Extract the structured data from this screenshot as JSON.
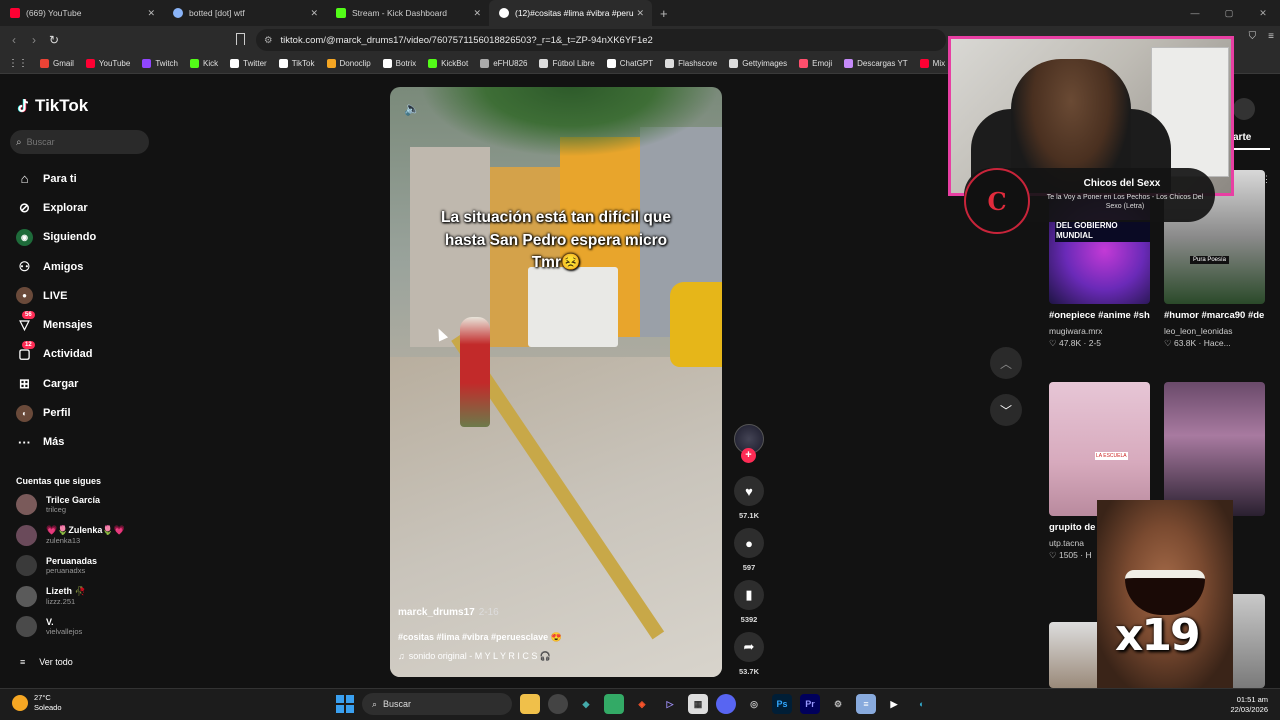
{
  "browser": {
    "tabs": [
      {
        "label": "(669) YouTube",
        "color": "#ff0033"
      },
      {
        "label": "botted [dot] wtf",
        "color": "#8ab4f8"
      },
      {
        "label": "Stream - Kick Dashboard",
        "color": "#53fc18"
      },
      {
        "label": "(12)#cositas #lima #vibra #peru",
        "color": "#ffffff"
      }
    ],
    "url": "tiktok.com/@marck_drums17/video/7607571156018826503?_r=1&_t=ZP-94nXK6YF1e2",
    "bookmarks": [
      {
        "label": "Gmail",
        "color": "#ea4335"
      },
      {
        "label": "YouTube",
        "color": "#ff0033"
      },
      {
        "label": "Twitch",
        "color": "#9146ff"
      },
      {
        "label": "Kick",
        "color": "#53fc18"
      },
      {
        "label": "Twitter",
        "color": "#ffffff"
      },
      {
        "label": "TikTok",
        "color": "#ffffff"
      },
      {
        "label": "Donoclip",
        "color": "#f5a623"
      },
      {
        "label": "Botrix",
        "color": "#ffffff"
      },
      {
        "label": "KickBot",
        "color": "#53fc18"
      },
      {
        "label": "eFHU826",
        "color": "#aaaaaa"
      },
      {
        "label": "Fútbol Libre",
        "color": "#dddddd"
      },
      {
        "label": "ChatGPT",
        "color": "#ffffff"
      },
      {
        "label": "Flashscore",
        "color": "#dddddd"
      },
      {
        "label": "Gettyimages",
        "color": "#dddddd"
      },
      {
        "label": "Emoji",
        "color": "#ff4f6d"
      },
      {
        "label": "Descargas YT",
        "color": "#c58af9"
      },
      {
        "label": "Mix N",
        "color": "#ff0033"
      }
    ]
  },
  "tiktok": {
    "logo": "TikTok",
    "search_placeholder": "Buscar",
    "menu": [
      {
        "label": "Para ti",
        "icon": "home-icon",
        "glyph": "⌂"
      },
      {
        "label": "Explorar",
        "icon": "compass-icon",
        "glyph": "⊘"
      },
      {
        "label": "Siguiendo",
        "icon": "following-icon",
        "glyph": "◉"
      },
      {
        "label": "Amigos",
        "icon": "friends-icon",
        "glyph": "⚇"
      },
      {
        "label": "LIVE",
        "icon": "live-icon",
        "glyph": "●"
      },
      {
        "label": "Mensajes",
        "icon": "messages-icon",
        "glyph": "▽",
        "badge": "56"
      },
      {
        "label": "Actividad",
        "icon": "activity-icon",
        "glyph": "▢",
        "badge": "12"
      },
      {
        "label": "Cargar",
        "icon": "upload-icon",
        "glyph": "⊞"
      },
      {
        "label": "Perfil",
        "icon": "profile-icon",
        "glyph": "◐"
      },
      {
        "label": "Más",
        "icon": "more-icon",
        "glyph": "···"
      }
    ],
    "following_header": "Cuentas que sigues",
    "following": [
      {
        "name": "Trilce García",
        "handle": "trilceg"
      },
      {
        "name": "💗🌷Zulenka🌷💗",
        "handle": "zulenka13"
      },
      {
        "name": "Peruanadas",
        "handle": "peruanadxs"
      },
      {
        "name": "Lizeth 🥀",
        "handle": "lizzz.251"
      },
      {
        "name": "V.",
        "handle": "vielvallejos"
      }
    ],
    "see_all": "Ver todo",
    "video": {
      "caption": "La situación está tan difícil que hasta San Pedro espera micro Tmr😣",
      "author": "marck_drums17",
      "date": "2-16",
      "description": "#cositas #lima #vibra #peruesclave 😍",
      "sound": "sonido original - M Y L Y R I C S 🎧"
    },
    "actions": {
      "likes": "57.1K",
      "comments": "597",
      "saves": "5392",
      "shares": "53.7K"
    },
    "right_tab": "arte",
    "cards": [
      {
        "title": "#onepiece #anime #shanks...",
        "user": "mugiwara.mrx",
        "stats": "♡ 47.8K · 2-5",
        "thumb_label": "DEL GOBIERNO MUNDIAL"
      },
      {
        "title": "#humor #marca90 #deportes #vide...",
        "user": "leo_leon_leonidas",
        "stats": "♡ 63.8K · Hace...",
        "thumb_label": "Pura Poesía"
      },
      {
        "title": "grupito de cachimbos",
        "user": "utp.tacna",
        "stats": "♡ 1505 · H",
        "thumb_label": "LA ESCUELA"
      },
      {
        "title": "#...na...",
        "user": "",
        "stats": "",
        "thumb_label": ""
      }
    ]
  },
  "overlay": {
    "song_title": "Chicos del Sexx",
    "song_subtitle": "Te la Voy a Poner en Los Pechos - Los Chicos Del Sexo (Letra)",
    "meme_text": "x19",
    "accent": "#e83fa3"
  },
  "taskbar": {
    "temperature": "27°C",
    "weather": "Soleado",
    "search": "Buscar",
    "time": "01:51 am",
    "date": "22/03/2026"
  }
}
